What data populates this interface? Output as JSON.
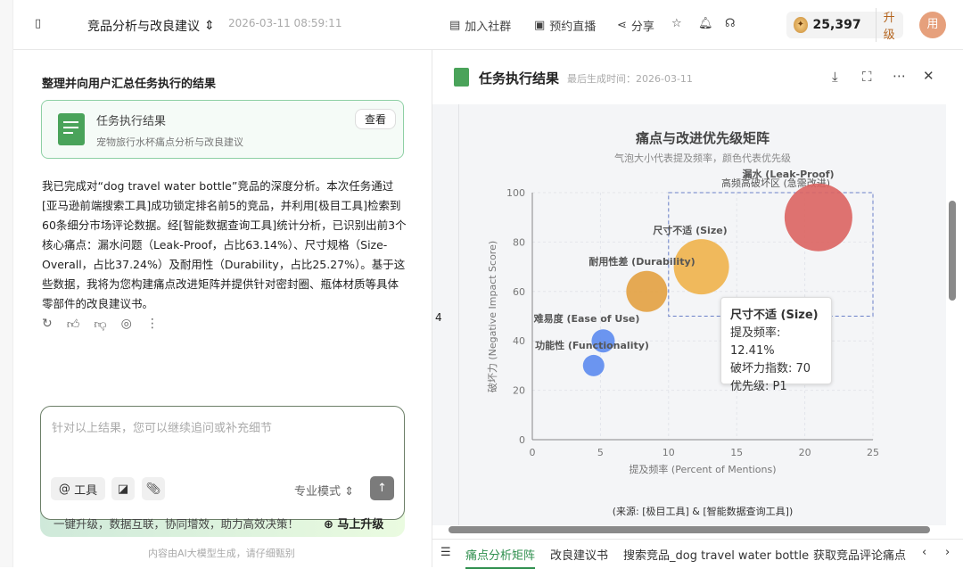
{
  "header": {
    "title": "竞品分析与改良建议",
    "timestamp": "2026-03-11 08:59:11",
    "join_group": "加入社群",
    "live": "预约直播",
    "share": "分享",
    "coins": "25,397",
    "upgrade": "升级",
    "avatar": "用"
  },
  "chat": {
    "step_title": "整理并向用户汇总任务执行的结果",
    "card_title": "任务执行结果",
    "card_subtitle": "宠物旅行水杯痛点分析与改良建议",
    "card_view": "查看",
    "message": "我已完成对“dog travel water bottle”竞品的深度分析。本次任务通过[亚马逊前端搜索工具]成功锁定排名前5的竞品，并利用[极目工具]检索到60条细分市场评论数据。经[智能数据查询工具]统计分析，已识别出前3个核心痛点：漏水问题（Leak-Proof，占比63.14%）、尺寸规格（Size-Overall，占比37.24%）及耐用性（Durability，占比25.27%）。基于这些数据，我将为您构建痛点改进矩阵并提供针对密封圈、瓶体材质等具体零部件的改良建议书。",
    "input_placeholder": "针对以上结果，您可以继续追问或补充细节",
    "tools": "工具",
    "mode": "专业模式",
    "upgrade_text": "一键升级，数据互联，协同增效，助力高效决策！",
    "upgrade_btn": "马上升级",
    "disclaimer": "内容由AI大模型生成，请仔细甄别"
  },
  "panel": {
    "title": "任务执行结果",
    "generated": "最后生成时间：2026-03-11",
    "line_no": "4",
    "tabs": [
      "痛点分析矩阵",
      "改良建议书",
      "搜索竞品_dog travel water bottle",
      "获取竞品评论痛点"
    ]
  },
  "chart_data": {
    "type": "scatter",
    "title": "痛点与改进优先级矩阵",
    "subtitle": "气泡大小代表提及频率，颜色代表优先级",
    "xlabel": "提及频率 (Percent of Mentions)",
    "ylabel": "破坏力 (Negative Impact Score)",
    "xlim": [
      0,
      25
    ],
    "ylim": [
      0,
      100
    ],
    "xticks": [
      0,
      5,
      10,
      15,
      20,
      25
    ],
    "yticks": [
      0,
      20,
      40,
      60,
      80,
      100
    ],
    "zone_label": "高频高破坏区 (急需改进)",
    "zone": {
      "x": [
        10,
        25
      ],
      "y": [
        50,
        100
      ]
    },
    "points": [
      {
        "label": "漏水 (Leak-Proof)",
        "x": 21,
        "y": 90,
        "size": 38,
        "color": "#dc6460"
      },
      {
        "label": "尺寸不适 (Size)",
        "x": 12.41,
        "y": 70,
        "size": 31,
        "color": "#efb24a"
      },
      {
        "label": "耐用性差 (Durability)",
        "x": 8.4,
        "y": 60,
        "size": 23,
        "color": "#e3a140"
      },
      {
        "label": "难易度 (Ease of Use)",
        "x": 5.2,
        "y": 40,
        "size": 13,
        "color": "#5c8bee"
      },
      {
        "label": "功能性 (Functionality)",
        "x": 4.5,
        "y": 30,
        "size": 12,
        "color": "#5c8bee"
      }
    ],
    "tooltip": {
      "title": "尺寸不适 (Size)",
      "lines": [
        "提及频率: 12.41%",
        "破坏力指数: 70",
        "优先级: P1"
      ]
    },
    "source": "(来源: [极目工具] & [智能数据查询工具])"
  }
}
